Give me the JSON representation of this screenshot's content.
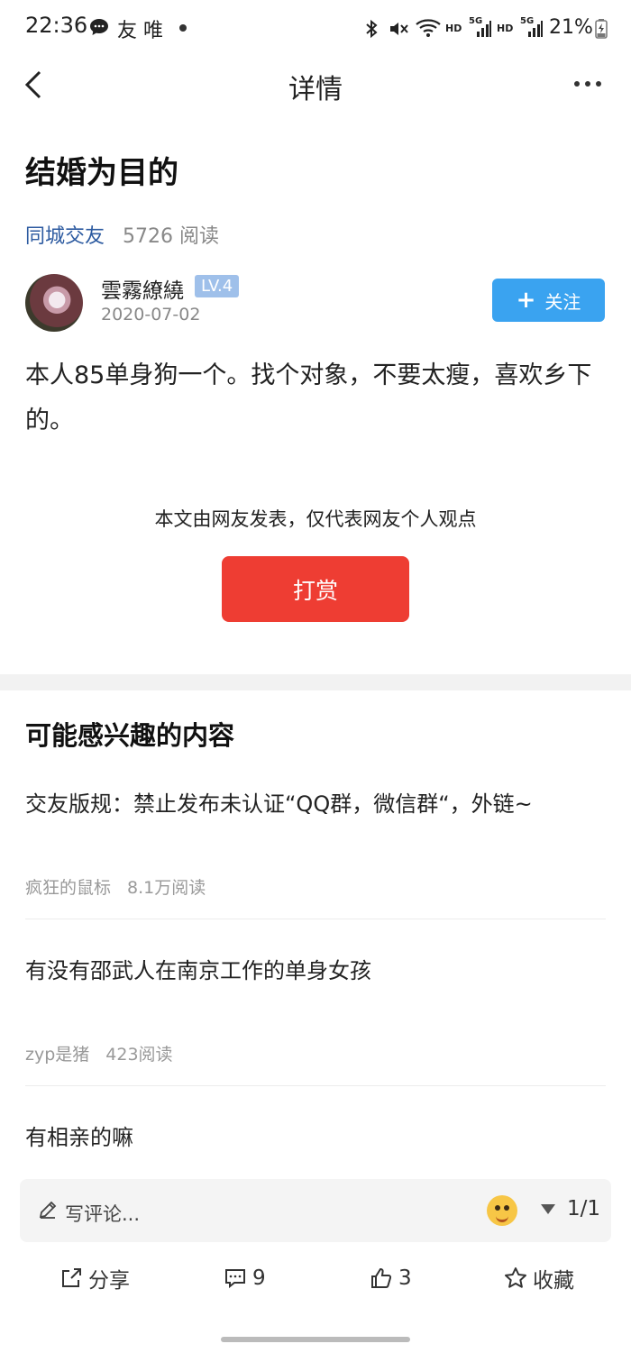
{
  "status_bar": {
    "time": "22:36",
    "notif_text": "友 唯",
    "net_hd1": "HD",
    "net_hd2": "HD",
    "net_5g1": "5G",
    "net_5g2": "5G",
    "battery": "21%"
  },
  "nav": {
    "title": "详情"
  },
  "post": {
    "title": "结婚为目的",
    "category": "同城交友",
    "reads": "5726 阅读",
    "author": "雲霧繚繞",
    "level": "LV.4",
    "date": "2020-07-02",
    "follow_label": "关注",
    "body": "本人85单身狗一个。找个对象，不要太瘦，喜欢乡下的。",
    "disclaimer": "本文由网友发表，仅代表网友个人观点",
    "reward_label": "打赏"
  },
  "related": {
    "heading": "可能感兴趣的内容",
    "items": [
      {
        "title": "交友版规：禁止发布未认证“QQ群，微信群“，外链~",
        "author": "疯狂的鼠标",
        "reads": "8.1万阅读"
      },
      {
        "title": "有没有邵武人在南京工作的单身女孩",
        "author": "zyp是猪",
        "reads": "423阅读"
      },
      {
        "title": "有相亲的嘛"
      }
    ]
  },
  "comment_bar": {
    "placeholder": "写评论...",
    "page": "1/1"
  },
  "actions": {
    "share": "分享",
    "comments": "9",
    "likes": "3",
    "favorite": "收藏"
  },
  "colors": {
    "accent_blue": "#3aa3f0",
    "reward_red": "#ee3d33",
    "category_blue": "#2c5aa0",
    "level_badge": "#9fc0ea"
  }
}
